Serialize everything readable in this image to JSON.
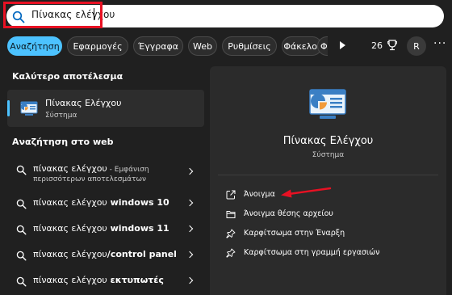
{
  "search": {
    "query": "Πίνακας ελέγχου"
  },
  "tabs": [
    {
      "label": "Αναζήτηση",
      "active": true
    },
    {
      "label": "Εφαρμογές",
      "active": false
    },
    {
      "label": "Έγγραφα",
      "active": false
    },
    {
      "label": "Web",
      "active": false
    },
    {
      "label": "Ρυθμίσεις",
      "active": false
    },
    {
      "label": "Φάκελοι",
      "active": false
    },
    {
      "label": "Φ",
      "active": false
    }
  ],
  "rewards": {
    "points": "26"
  },
  "account": {
    "initial": "R"
  },
  "best_match": {
    "section_title": "Καλύτερο αποτέλεσμα",
    "title": "Πίνακας Ελέγχου",
    "subtitle": "Σύστημα"
  },
  "web": {
    "section_title": "Αναζήτηση στο web",
    "items": [
      {
        "query": "πίνακας ελέγχου",
        "suffix": " - Εμφάνιση",
        "line2": "περισσότερων αποτελεσμάτων"
      },
      {
        "query": "πίνακας ελέγχου",
        "bold": " windows 10"
      },
      {
        "query": "πίνακας ελέγχου",
        "bold": " windows 11"
      },
      {
        "query": "πίνακας ελέγχου",
        "bold": "/control panel"
      },
      {
        "query": "πίνακας ελέγχου",
        "bold": " εκτυπωτές"
      }
    ]
  },
  "detail": {
    "title": "Πίνακας Ελέγχου",
    "subtitle": "Σύστημα",
    "actions": [
      {
        "label": "Άνοιγμα",
        "icon": "open-icon"
      },
      {
        "label": "Άνοιγμα θέσης αρχείου",
        "icon": "folder-icon"
      },
      {
        "label": "Καρφίτσωμα στην Έναρξη",
        "icon": "pin-icon"
      },
      {
        "label": "Καρφίτσωμα στη γραμμή εργασιών",
        "icon": "pin-icon"
      }
    ]
  },
  "colors": {
    "accent": "#4cc2ff",
    "highlight": "#e81123",
    "background": "#202020",
    "panel": "#2b2b2b"
  }
}
